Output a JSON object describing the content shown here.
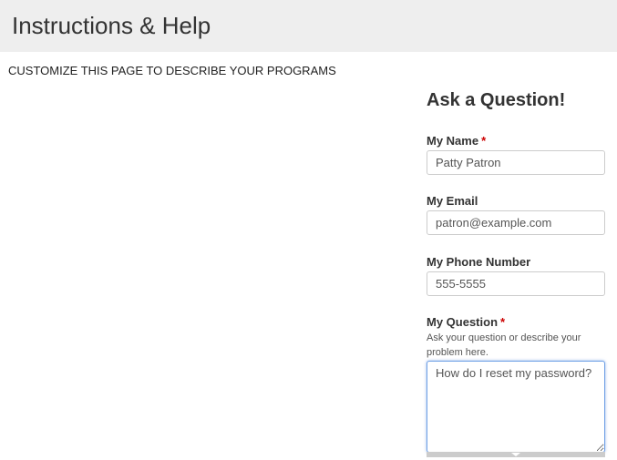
{
  "header": {
    "title": "Instructions & Help"
  },
  "intro": {
    "text": "CUSTOMIZE THIS PAGE TO DESCRIBE YOUR PROGRAMS"
  },
  "form": {
    "title": "Ask a Question!",
    "name": {
      "label": "My Name",
      "required_mark": "*",
      "value": "Patty Patron"
    },
    "email": {
      "label": "My Email",
      "value": "patron@example.com"
    },
    "phone": {
      "label": "My Phone Number",
      "value": "555-5555"
    },
    "question": {
      "label": "My Question",
      "required_mark": "*",
      "help": "Ask your question or describe your problem here.",
      "value": "How do I reset my password?"
    }
  },
  "colors": {
    "header_bg": "#eeeeee",
    "required": "#cc0000",
    "focus_border": "#6fa0e6"
  }
}
